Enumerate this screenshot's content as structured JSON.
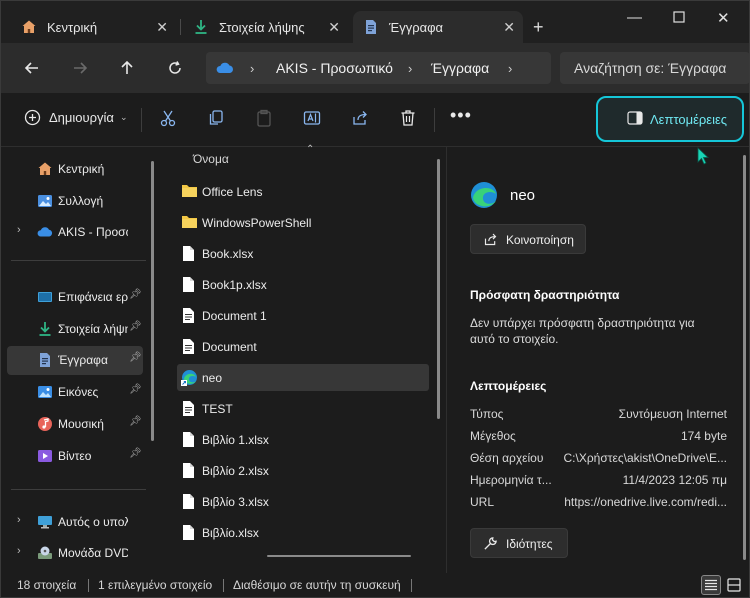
{
  "tabs": [
    {
      "label": "Κεντρική",
      "icon": "home-icon"
    },
    {
      "label": "Στοιχεία λήψης",
      "icon": "download-icon"
    },
    {
      "label": "Έγγραφα",
      "icon": "document-icon",
      "active": true
    }
  ],
  "breadcrumb": {
    "root": "AKIS - Προσωπικό",
    "current": "Έγγραφα"
  },
  "search": {
    "placeholder": "Αναζήτηση σε: Έγγραφα"
  },
  "toolbar": {
    "new_label": "Δημιουργία",
    "details_label": "Λεπτομέρειες"
  },
  "sidebar": {
    "groups": [
      [
        {
          "label": "Κεντρική",
          "icon": "home-icon"
        },
        {
          "label": "Συλλογή",
          "icon": "gallery-icon"
        },
        {
          "label": "AKIS - Προσωπικό",
          "icon": "onedrive-cloud-icon",
          "expandable": true
        }
      ],
      [
        {
          "label": "Επιφάνεια εργασίας",
          "icon": "desktop-icon",
          "pinned": true
        },
        {
          "label": "Στοιχεία λήψης",
          "icon": "download-icon",
          "pinned": true
        },
        {
          "label": "Έγγραφα",
          "icon": "document-icon",
          "pinned": true,
          "selected": true
        },
        {
          "label": "Εικόνες",
          "icon": "pictures-icon",
          "pinned": true
        },
        {
          "label": "Μουσική",
          "icon": "music-icon",
          "pinned": true
        },
        {
          "label": "Βίντεο",
          "icon": "video-icon",
          "pinned": true
        }
      ],
      [
        {
          "label": "Αυτός ο υπολογιστής",
          "icon": "this-pc-icon",
          "expandable": true
        },
        {
          "label": "Μονάδα DVD (D:)",
          "icon": "dvd-drive-icon",
          "expandable": true
        }
      ]
    ]
  },
  "file_list": {
    "column_header": "Όνομα",
    "items": [
      {
        "name": "Office Lens",
        "icon": "folder-icon"
      },
      {
        "name": "WindowsPowerShell",
        "icon": "folder-icon"
      },
      {
        "name": "Book.xlsx",
        "icon": "file-icon"
      },
      {
        "name": "Book1p.xlsx",
        "icon": "file-icon"
      },
      {
        "name": "Document 1",
        "icon": "text-file-icon"
      },
      {
        "name": "Document",
        "icon": "text-file-icon"
      },
      {
        "name": "neo",
        "icon": "edge-shortcut-icon",
        "selected": true
      },
      {
        "name": "TEST",
        "icon": "text-file-icon"
      },
      {
        "name": "Βιβλίο 1.xlsx",
        "icon": "file-icon"
      },
      {
        "name": "Βιβλίο 2.xlsx",
        "icon": "file-icon"
      },
      {
        "name": "Βιβλίο 3.xlsx",
        "icon": "file-icon"
      },
      {
        "name": "Βιβλίο.xlsx",
        "icon": "file-icon"
      }
    ]
  },
  "details_pane": {
    "title": "neo",
    "share_label": "Κοινοποίηση",
    "activity_heading": "Πρόσφατη δραστηριότητα",
    "activity_text": "Δεν υπάρχει πρόσφατη δραστηριότητα για αυτό το στοιχείο.",
    "details_heading": "Λεπτομέρειες",
    "properties": [
      {
        "key": "Τύπος",
        "value": "Συντόμευση Internet"
      },
      {
        "key": "Μέγεθος",
        "value": "174 byte"
      },
      {
        "key": "Θέση αρχείου",
        "value": "C:\\Χρήστες\\akist\\OneDrive\\E..."
      },
      {
        "key": "Ημερομηνία τ...",
        "value": "11/4/2023 12:05 πμ"
      },
      {
        "key": "URL",
        "value": "https://onedrive.live.com/redi..."
      }
    ],
    "properties_label": "Ιδιότητες"
  },
  "status": {
    "count": "18 στοιχεία",
    "selected": "1 επιλεγμένο στοιχείο",
    "availability": "Διαθέσιμο σε αυτήν τη συσκευή"
  },
  "colors": {
    "accent": "#15c6d8",
    "background": "#1c1c1c",
    "selected": "#373737"
  }
}
